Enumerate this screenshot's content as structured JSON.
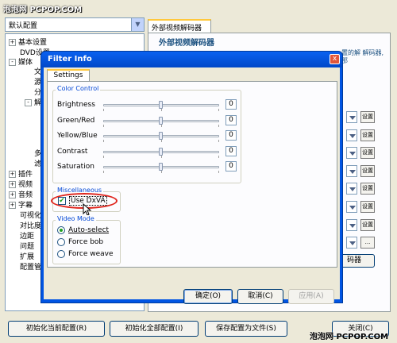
{
  "watermark_top": "泡泡网 PCPOP.COM",
  "watermark_bottom": "泡泡网 PCPOP.COM",
  "profile_combo": {
    "value": "默认配置"
  },
  "tree": [
    {
      "label": "基本设置",
      "expander": "+"
    },
    {
      "label": "DVD设置",
      "expander": ""
    },
    {
      "label": "媒体",
      "expander": "-"
    },
    {
      "label": "文",
      "expander": ""
    },
    {
      "label": "源",
      "expander": ""
    },
    {
      "label": "分",
      "expander": ""
    },
    {
      "label": "解",
      "expander": "-"
    },
    {
      "label": "多",
      "expander": ""
    },
    {
      "label": "滤",
      "expander": ""
    },
    {
      "label": "插件",
      "expander": "+"
    },
    {
      "label": "视频",
      "expander": "+"
    },
    {
      "label": "音频",
      "expander": "+"
    },
    {
      "label": "字幕",
      "expander": "+"
    },
    {
      "label": "可视化",
      "expander": ""
    },
    {
      "label": "对比度",
      "expander": ""
    },
    {
      "label": "边距",
      "expander": ""
    },
    {
      "label": "问题",
      "expander": ""
    },
    {
      "label": "扩展",
      "expander": ""
    },
    {
      "label": "配置管",
      "expander": ""
    }
  ],
  "right_panel": {
    "tab": "外部视频解码器",
    "title": "外部视频解码器",
    "desc": "置的解 解码器,那",
    "settings_btn": "设置",
    "more_btn": "...",
    "bottom_btn": "码器"
  },
  "bottom_buttons": {
    "init_current": "初始化当前配置(R)",
    "init_all": "初始化全部配置(I)",
    "save_as": "保存配置为文件(S)",
    "close": "关闭(C)"
  },
  "dialog": {
    "title": "Filter Info",
    "close_glyph": "x",
    "tab": "Settings",
    "color_control": {
      "legend": "Color Control",
      "sliders": [
        {
          "label": "Brightness",
          "value": "0"
        },
        {
          "label": "Green/Red",
          "value": "0"
        },
        {
          "label": "Yellow/Blue",
          "value": "0"
        },
        {
          "label": "Contrast",
          "value": "0"
        },
        {
          "label": "Saturation",
          "value": "0"
        }
      ]
    },
    "misc": {
      "legend": "Miscellaneous",
      "use_dxva": {
        "label": "Use DxVA",
        "checked": true,
        "glyph": "✔"
      }
    },
    "video_mode": {
      "legend": "Video Mode",
      "options": [
        {
          "label": "Auto-select",
          "selected": true
        },
        {
          "label": "Force bob",
          "selected": false
        },
        {
          "label": "Force weave",
          "selected": false
        }
      ]
    },
    "buttons": {
      "ok": "确定(O)",
      "cancel": "取消(C)",
      "apply": "应用(A)"
    }
  },
  "colors": {
    "title_bar": "#0054e3",
    "accent": "#0046d5",
    "highlight": "#e0261e"
  },
  "icons": [
    "close-icon",
    "cursor-icon",
    "dropdown-arrow-icon"
  ]
}
